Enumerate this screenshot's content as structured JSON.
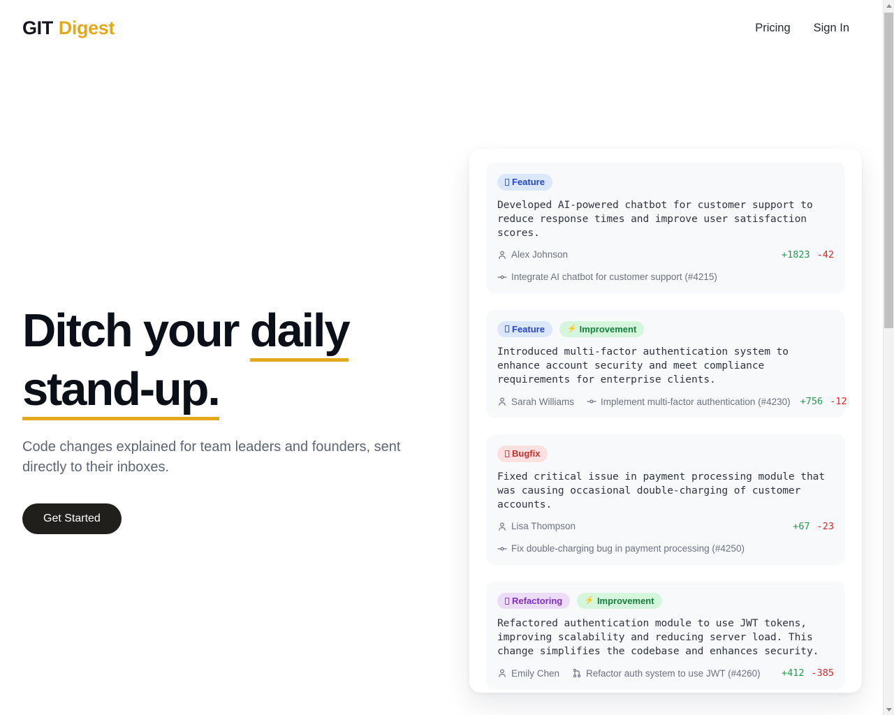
{
  "header": {
    "logo_primary": "GIT",
    "logo_accent": "Digest",
    "nav": [
      {
        "label": "Pricing",
        "name": "nav-link-pricing"
      },
      {
        "label": "Sign In",
        "name": "nav-link-sign-in"
      }
    ]
  },
  "hero": {
    "title_plain": "Ditch your ",
    "title_highlight": "daily stand-up.",
    "subtitle": "Code changes explained for team leaders and founders, sent directly to their inboxes.",
    "cta_label": "Get Started"
  },
  "colors": {
    "accent": "#e3a81c",
    "cta_background": "#211f1c",
    "additions": "#1f9d4d",
    "deletions": "#dc2626",
    "badge_feature_bg": "#dbe7fb",
    "badge_feature_text": "#2546c9",
    "badge_improvement_bg": "#d6f5dd",
    "badge_improvement_text": "#15803d",
    "badge_bugfix_bg": "#fde0e0",
    "badge_bugfix_text": "#c32f2f",
    "badge_refactoring_bg": "#eddcf7",
    "badge_refactoring_text": "#7d2ec4",
    "card_background": "#f7f9fb"
  },
  "preview": {
    "cards": [
      {
        "badges": [
          {
            "label": "Feature",
            "type": "feature",
            "glyph": "tofu"
          }
        ],
        "summary": "Developed AI-powered chatbot for customer support to reduce response times and improve user satisfaction scores.",
        "author": "Alex Johnson",
        "reference": "Integrate AI chatbot for customer support (#4215)",
        "reference_icon": "git-commit-icon",
        "additions": "+1823",
        "deletions": "-42",
        "layout": "stacked"
      },
      {
        "badges": [
          {
            "label": "Feature",
            "type": "feature",
            "glyph": "tofu"
          },
          {
            "label": "Improvement",
            "type": "improvement",
            "glyph": "⚡"
          }
        ],
        "summary": "Introduced multi-factor authentication system to enhance account security and meet compliance requirements for enterprise clients.",
        "author": "Sarah Williams",
        "reference": "Implement multi-factor authentication (#4230)",
        "reference_icon": "git-commit-icon",
        "additions": "+756",
        "deletions": "-12",
        "layout": "inline"
      },
      {
        "badges": [
          {
            "label": "Bugfix",
            "type": "bugfix",
            "glyph": "tofu"
          }
        ],
        "summary": "Fixed critical issue in payment processing module that was causing occasional double-charging of customer accounts.",
        "author": "Lisa Thompson",
        "reference": "Fix double-charging bug in payment processing (#4250)",
        "reference_icon": "git-commit-icon",
        "additions": "+67",
        "deletions": "-23",
        "layout": "stacked"
      },
      {
        "badges": [
          {
            "label": "Refactoring",
            "type": "refactoring",
            "glyph": "tofu"
          },
          {
            "label": "Improvement",
            "type": "improvement",
            "glyph": "⚡"
          }
        ],
        "summary": "Refactored authentication module to use JWT tokens, improving scalability and reducing server load. This change simplifies the codebase and enhances security.",
        "author": "Emily Chen",
        "reference": "Refactor auth system to use JWT (#4260)",
        "reference_icon": "git-pull-request-icon",
        "additions": "+412",
        "deletions": "-385",
        "layout": "inline"
      }
    ]
  }
}
